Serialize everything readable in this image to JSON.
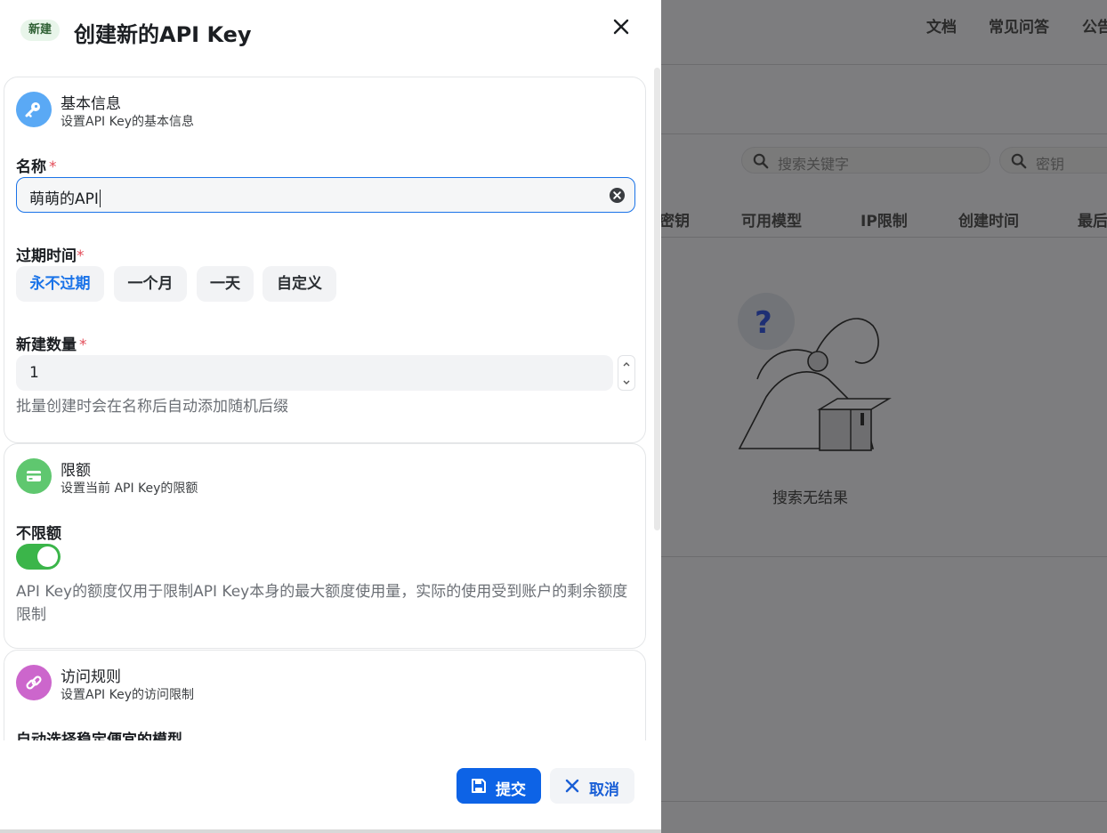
{
  "background": {
    "nav": [
      "文档",
      "常见问答",
      "公告"
    ],
    "search_keyword_placeholder": "搜索关键字",
    "search_key_placeholder": "密钥",
    "table_headers": [
      "密钥",
      "可用模型",
      "IP限制",
      "创建时间",
      "最后"
    ],
    "empty_text": "搜索无结果"
  },
  "header": {
    "tag": "新建",
    "title": "创建新的API Key"
  },
  "basic": {
    "title": "基本信息",
    "subtitle": "设置API Key的基本信息",
    "name_label": "名称",
    "name_value": "萌萌的API",
    "expire_label": "过期时间",
    "expire_options": [
      "永不过期",
      "一个月",
      "一天",
      "自定义"
    ],
    "expire_selected": "永不过期",
    "count_label": "新建数量",
    "count_value": "1",
    "count_help": "批量创建时会在名称后自动添加随机后缀",
    "required_mark": "*"
  },
  "quota": {
    "title": "限额",
    "subtitle": "设置当前 API Key的限额",
    "unlimited_label": "不限额",
    "unlimited_on": true,
    "help": "API Key的额度仅用于限制API Key本身的最大额度使用量，实际的使用受到账户的剩余额度限制"
  },
  "access": {
    "title": "访问规则",
    "subtitle": "设置API Key的访问限制",
    "auto_model_label": "自动选择稳定便宜的模型"
  },
  "footer": {
    "submit": "提交",
    "cancel": "取消"
  },
  "colors": {
    "primary": "#0d63e6",
    "toggle_on": "#3bb54a",
    "basic_icon": "#5aa9f5",
    "quota_icon": "#5fc76f",
    "access_icon": "#cc66cc"
  }
}
